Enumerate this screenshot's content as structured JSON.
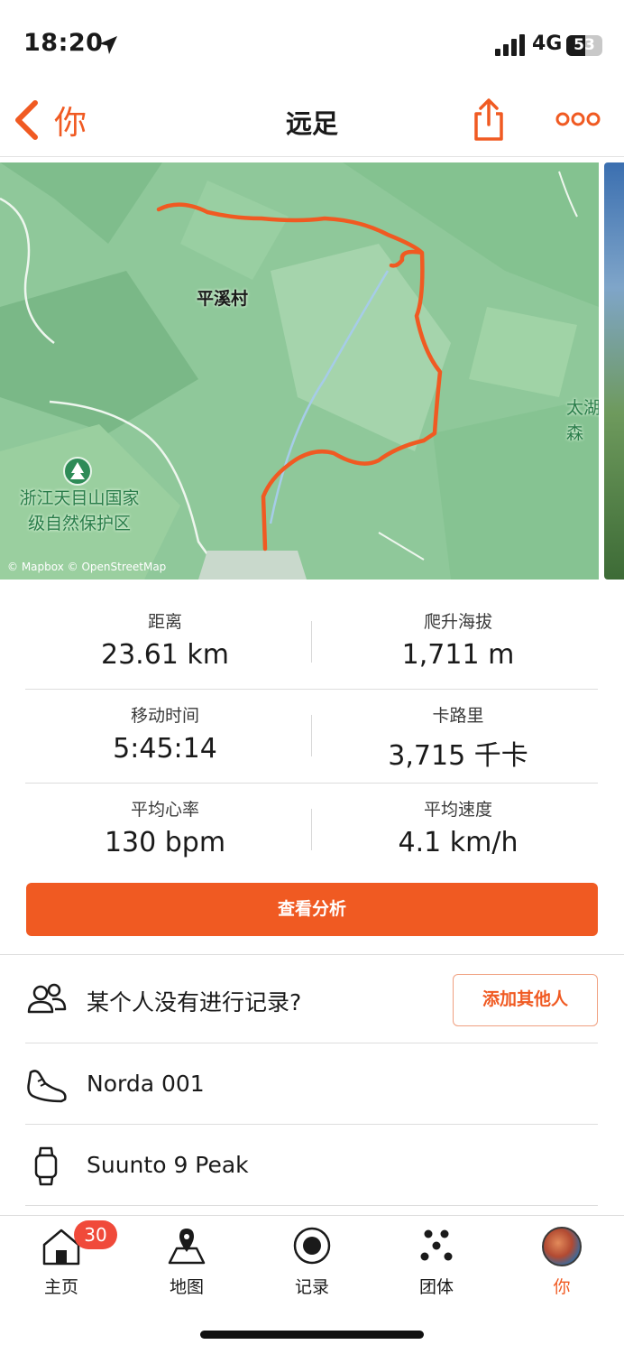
{
  "status_bar": {
    "time": "18:20",
    "network": "4G",
    "battery_level": "53",
    "battery_fraction": 0.53,
    "icons": [
      "location-arrow-icon",
      "signal-icon",
      "battery-icon"
    ]
  },
  "nav": {
    "back_label": "你",
    "title": "远足",
    "icons": [
      "chevron-left-icon",
      "share-icon",
      "more-icon"
    ]
  },
  "map": {
    "labels": {
      "village": "平溪村",
      "reserve_line1": "浙江天目山国家",
      "reserve_line2": "级自然保护区",
      "edge_line1": "太湖",
      "edge_line2": "森"
    },
    "attribution": "© Mapbox © OpenStreetMap",
    "route_color": "#f05a22"
  },
  "stats": [
    {
      "label": "距离",
      "value": "23.61 km"
    },
    {
      "label": "爬升海拔",
      "value": "1,711 m"
    },
    {
      "label": "移动时间",
      "value": "5:45:14"
    },
    {
      "label": "卡路里",
      "value": "3,715 千卡"
    },
    {
      "label": "平均心率",
      "value": "130 bpm"
    },
    {
      "label": "平均速度",
      "value": "4.1 km/h"
    }
  ],
  "analysis_button": "查看分析",
  "group": {
    "text": "某个人没有进行记录?",
    "button": "添加其他人"
  },
  "gear": {
    "shoes": "Norda 001",
    "watch": "Suunto 9 Peak"
  },
  "tab_bar": {
    "items": [
      {
        "label": "主页",
        "icon": "home-icon"
      },
      {
        "label": "地图",
        "icon": "map-pin-icon"
      },
      {
        "label": "记录",
        "icon": "record-icon"
      },
      {
        "label": "团体",
        "icon": "groups-icon"
      },
      {
        "label": "你",
        "icon": "avatar"
      }
    ],
    "badge": "30",
    "active_color": "#f05a22"
  },
  "colors": {
    "accent": "#f05a22",
    "map_green": "#8fc89a"
  }
}
